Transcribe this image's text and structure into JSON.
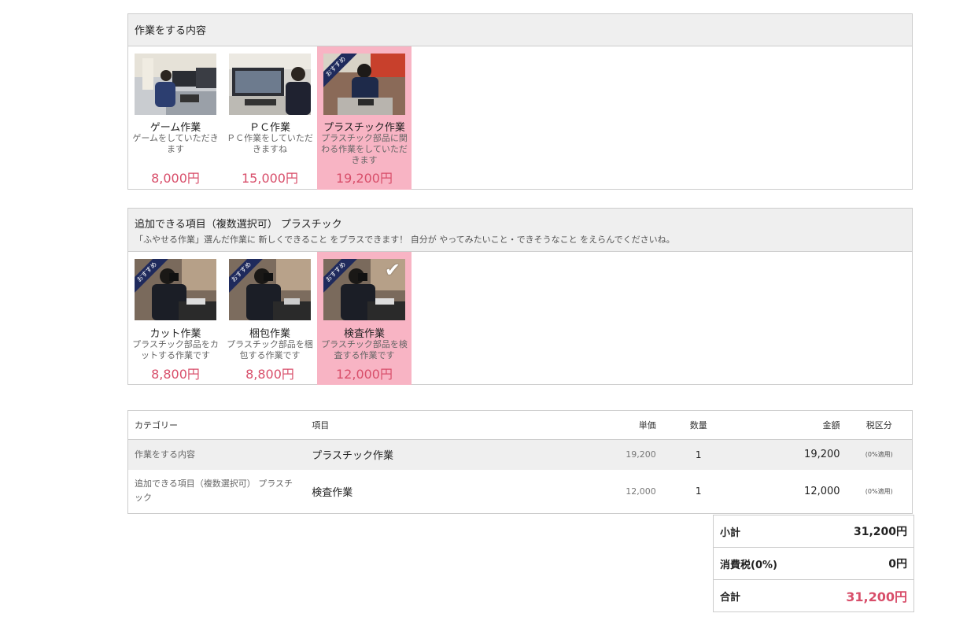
{
  "section1": {
    "title": "作業をする内容",
    "cards": [
      {
        "name": "ゲーム作業",
        "desc": "ゲームをしていただきます",
        "price": "8,000円",
        "recommended": false,
        "selected": false
      },
      {
        "name": "ＰＣ作業",
        "desc": "ＰＣ作業をしていただきますね",
        "price": "15,000円",
        "recommended": false,
        "selected": false
      },
      {
        "name": "プラスチック作業",
        "desc": "プラスチック部品に関わる作業をしていただきます",
        "price": "19,200円",
        "recommended": true,
        "selected": true
      }
    ]
  },
  "section2": {
    "title": "追加できる項目（複数選択可） プラスチック",
    "subtitle": "「ふやせる作業」選んだ作業に 新しくできること をプラスできます！ 自分が やってみたいこと・できそうなこと をえらんでくださいね。",
    "cards": [
      {
        "name": "カット作業",
        "desc": "プラスチック部品をカットする作業です",
        "price": "8,800円",
        "recommended": true,
        "selected": false
      },
      {
        "name": "梱包作業",
        "desc": "プラスチック部品を梱包する作業です",
        "price": "8,800円",
        "recommended": true,
        "selected": false
      },
      {
        "name": "検査作業",
        "desc": "プラスチック部品を検査する作業です",
        "price": "12,000円",
        "recommended": true,
        "selected": true
      }
    ]
  },
  "badge_label": "おすすめ",
  "table": {
    "headers": {
      "category": "カテゴリー",
      "item": "項目",
      "unit_price": "単価",
      "quantity": "数量",
      "amount": "金額",
      "tax_class": "税区分"
    },
    "rows": [
      {
        "category": "作業をする内容",
        "item": "プラスチック作業",
        "unit_price": "19,200",
        "quantity": "1",
        "amount": "19,200",
        "tax": "(0%適用)"
      },
      {
        "category": "追加できる項目（複数選択可） プラスチック",
        "item": "検査作業",
        "unit_price": "12,000",
        "quantity": "1",
        "amount": "12,000",
        "tax": "(0%適用)"
      }
    ]
  },
  "totals": {
    "subtotal_label": "小計",
    "subtotal": "31,200円",
    "tax_label": "消費税(0%)",
    "tax": "0円",
    "total_label": "合計",
    "total": "31,200円"
  },
  "colors": {
    "selected_bg": "#f8b4c4",
    "price": "#d84e6a",
    "badge": "#1f2a5c",
    "header_bg": "#efefef"
  }
}
